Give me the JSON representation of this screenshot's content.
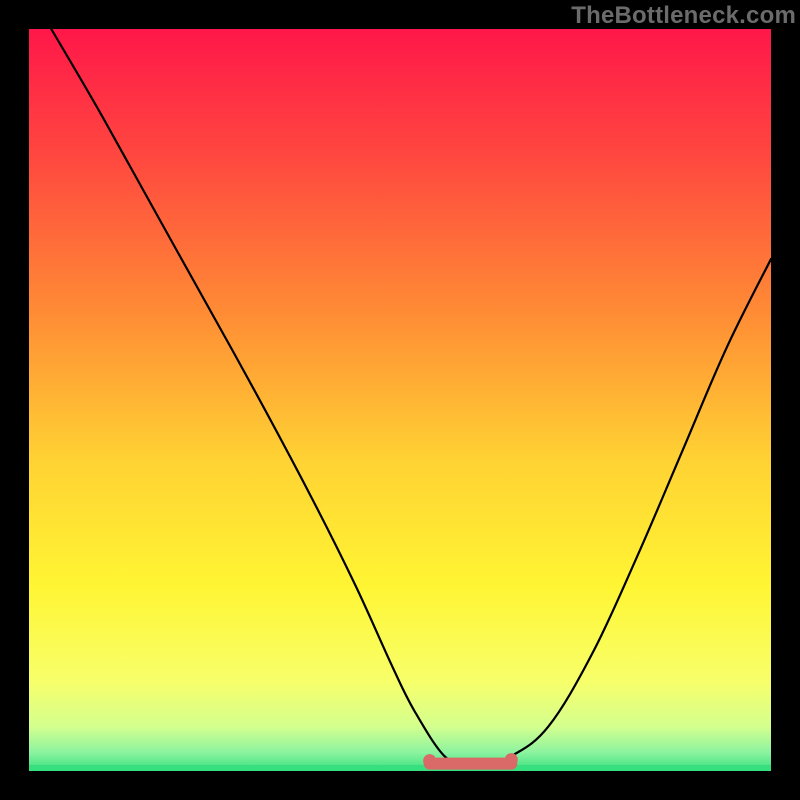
{
  "watermark": {
    "text": "TheBottleneck.com"
  },
  "chart_data": {
    "type": "line",
    "title": "",
    "xlabel": "",
    "ylabel": "",
    "xlim": [
      0,
      100
    ],
    "ylim": [
      0,
      100
    ],
    "grid": false,
    "legend": false,
    "series": [
      {
        "name": "curve",
        "color": "#000000",
        "x": [
          3,
          10,
          20,
          30,
          38,
          44,
          49,
          52,
          56,
          59,
          62,
          65,
          70,
          76,
          82,
          88,
          94,
          100
        ],
        "y": [
          100,
          88,
          70,
          52,
          37,
          25,
          14,
          8,
          2,
          1,
          1,
          2,
          6,
          16,
          29,
          43,
          57,
          69
        ]
      }
    ],
    "flat_zone": {
      "x_start": 54,
      "x_end": 65,
      "y": 1,
      "color": "#d96a67"
    },
    "bottom_band": {
      "y": 0,
      "height": 4,
      "color": "#37e07e"
    },
    "background": {
      "type": "vertical-gradient",
      "stops": [
        {
          "offset": 0.0,
          "color": "#ff1749"
        },
        {
          "offset": 0.18,
          "color": "#ff4a3f"
        },
        {
          "offset": 0.38,
          "color": "#ff8b35"
        },
        {
          "offset": 0.58,
          "color": "#ffd233"
        },
        {
          "offset": 0.75,
          "color": "#fff533"
        },
        {
          "offset": 0.88,
          "color": "#f7ff6a"
        },
        {
          "offset": 0.94,
          "color": "#d4ff8e"
        },
        {
          "offset": 0.975,
          "color": "#8cf3a0"
        },
        {
          "offset": 1.0,
          "color": "#37e07e"
        }
      ]
    }
  }
}
